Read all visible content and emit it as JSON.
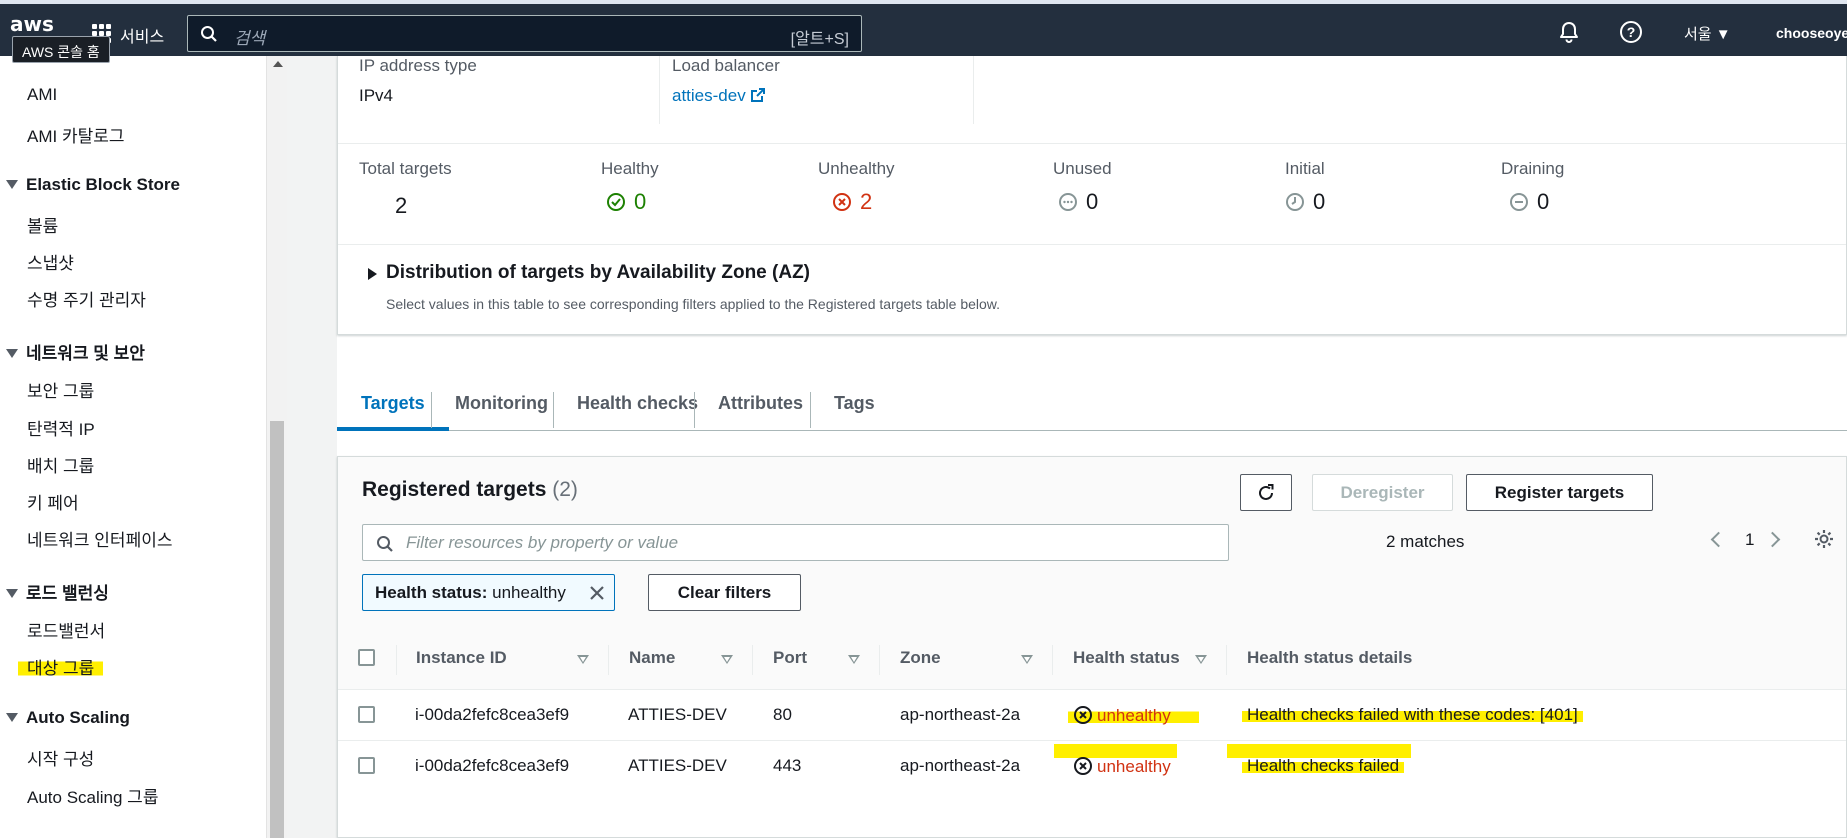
{
  "topbar": {
    "logo": "aws",
    "tooltip": "AWS 콘솔 홈",
    "services_label": "서비스",
    "search_placeholder": "검색",
    "search_shortcut": "[알트+S]",
    "region": "서울 ▼",
    "user": "chooseoye"
  },
  "sidebar": {
    "items_top": [
      "AMI",
      "AMI 카탈로그"
    ],
    "sections": [
      {
        "title": "Elastic Block Store",
        "items": [
          "볼륨",
          "스냅샷",
          "수명 주기 관리자"
        ]
      },
      {
        "title": "네트워크 및 보안",
        "items": [
          "보안 그룹",
          "탄력적 IP",
          "배치 그룹",
          "키 페어",
          "네트워크 인터페이스"
        ]
      },
      {
        "title": "로드 밸런싱",
        "items": [
          "로드밸런서",
          "대상 그룹"
        ]
      },
      {
        "title": "Auto Scaling",
        "items": [
          "시작 구성",
          "Auto Scaling 그룹"
        ]
      }
    ]
  },
  "details": {
    "ip_type_label": "IP address type",
    "ip_type_value": "IPv4",
    "lb_label": "Load balancer",
    "lb_value": "atties-dev"
  },
  "stats": [
    {
      "label": "Total targets",
      "value": "2",
      "icon": "none"
    },
    {
      "label": "Healthy",
      "value": "0",
      "icon": "check-circle-icon",
      "color": "#1d8102"
    },
    {
      "label": "Unhealthy",
      "value": "2",
      "icon": "x-circle-icon",
      "color": "#d13212"
    },
    {
      "label": "Unused",
      "value": "0",
      "icon": "dots-circle-icon",
      "color": "#16191f"
    },
    {
      "label": "Initial",
      "value": "0",
      "icon": "clock-circle-icon",
      "color": "#16191f"
    },
    {
      "label": "Draining",
      "value": "0",
      "icon": "minus-circle-icon",
      "color": "#16191f"
    }
  ],
  "distribution": {
    "title": "Distribution of targets by Availability Zone (AZ)",
    "subtitle": "Select values in this table to see corresponding filters applied to the Registered targets table below."
  },
  "tabs": [
    "Targets",
    "Monitoring",
    "Health checks",
    "Attributes",
    "Tags"
  ],
  "registered": {
    "title": "Registered targets",
    "count": "(2)",
    "deregister_label": "Deregister",
    "register_label": "Register targets",
    "filter_placeholder": "Filter resources by property or value",
    "matches": "2 matches",
    "page": "1",
    "token_key": "Health status:",
    "token_value": " unhealthy",
    "clear_filters": "Clear filters",
    "columns": [
      "Instance ID",
      "Name",
      "Port",
      "Zone",
      "Health status",
      "Health status details"
    ],
    "rows": [
      {
        "instance_id": "i-00da2fefc8cea3ef9",
        "name": "ATTIES-DEV",
        "port": "80",
        "zone": "ap-northeast-2a",
        "status": "unhealthy",
        "details": "Health checks failed with these codes: [401]"
      },
      {
        "instance_id": "i-00da2fefc8cea3ef9",
        "name": "ATTIES-DEV",
        "port": "443",
        "zone": "ap-northeast-2a",
        "status": "unhealthy",
        "details": "Health checks failed"
      }
    ]
  },
  "colors": {
    "accent": "#0073bb",
    "error": "#d13212",
    "success": "#1d8102",
    "highlight": "#ffef00",
    "topbar": "#232f3e"
  }
}
